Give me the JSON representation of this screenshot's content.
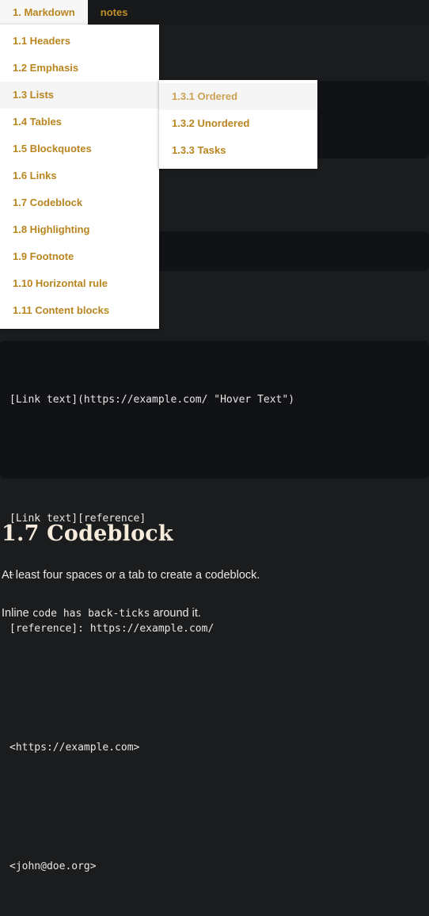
{
  "theme": {
    "page_bg": "#1a1c1e",
    "code_bg": "#101215",
    "accent_gold": "#b9851f",
    "heading_cream": "#f7ecdc",
    "menu_bg": "#ffffff",
    "menu_hover_bg": "#f5f5f5"
  },
  "tabs": [
    {
      "label": "1. Markdown",
      "active": true
    },
    {
      "label": "notes",
      "active": false
    }
  ],
  "menu_primary": {
    "items": [
      {
        "label": "1.1 Headers",
        "highlighted": false
      },
      {
        "label": "1.2 Emphasis",
        "highlighted": false
      },
      {
        "label": "1.3 Lists",
        "highlighted": true
      },
      {
        "label": "1.4 Tables",
        "highlighted": false
      },
      {
        "label": "1.5 Blockquotes",
        "highlighted": false
      },
      {
        "label": "1.6 Links",
        "highlighted": false
      },
      {
        "label": "1.7 Codeblock",
        "highlighted": false
      },
      {
        "label": "1.8 Highlighting",
        "highlighted": false
      },
      {
        "label": "1.9 Footnote",
        "highlighted": false
      },
      {
        "label": "1.10 Horizontal rule",
        "highlighted": false
      },
      {
        "label": "1.11 Content blocks",
        "highlighted": false
      }
    ]
  },
  "menu_secondary": {
    "items": [
      {
        "label": "1.3.1 Ordered",
        "highlighted": true
      },
      {
        "label": "1.3.2 Unordered",
        "highlighted": false
      },
      {
        "label": "1.3.3 Tasks",
        "highlighted": false
      }
    ]
  },
  "links_code": {
    "lines": [
      "[Link text](https://example.com/ \"Hover Text\")",
      "",
      "[Link text][reference]",
      "…",
      "[reference]: https://example.com/",
      "",
      "<https://example.com>",
      "",
      "<john@doe.org>"
    ],
    "line_1": "[Link text](https://example.com/ \"Hover Text\")",
    "line_2": "[Link text][reference]",
    "line_3": "…",
    "line_4": "[reference]: https://example.com/",
    "line_5": "<https://example.com>",
    "line_6": "<john@doe.org>"
  },
  "codeblock_section": {
    "heading": "1.7 Codeblock",
    "paragraph_1": "At least four spaces or a tab to create a codeblock.",
    "paragraph_2_before": "Inline ",
    "paragraph_2_code": "code has back-ticks",
    "paragraph_2_after": " around it."
  }
}
